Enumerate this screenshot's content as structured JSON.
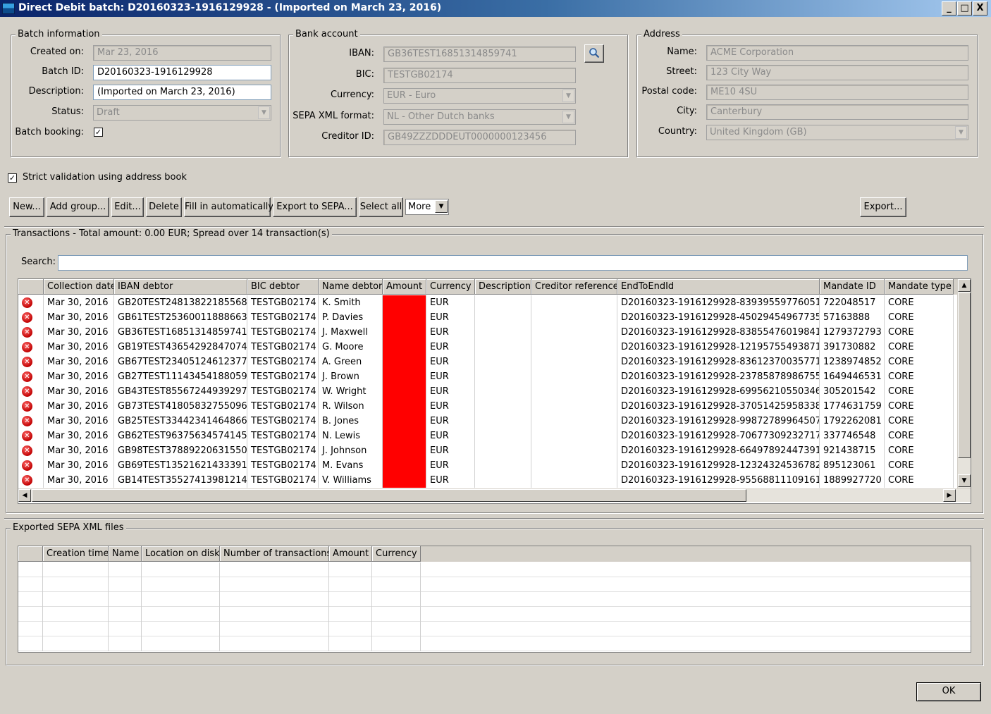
{
  "window": {
    "title": "Direct Debit batch: D20160323-1916129928 - (Imported on March 23, 2016)",
    "minimize": "_",
    "maximize": "□",
    "close": "X"
  },
  "batch": {
    "group_title": "Batch information",
    "created_label": "Created on:",
    "created_value": "Mar 23, 2016",
    "id_label": "Batch ID:",
    "id_value": "D20160323-1916129928",
    "desc_label": "Description:",
    "desc_value": "(Imported on March 23, 2016)",
    "status_label": "Status:",
    "status_value": "Draft",
    "booking_label": "Batch booking:",
    "booking_checked": "✓"
  },
  "bank": {
    "group_title": "Bank account",
    "iban_label": "IBAN:",
    "iban_value": "GB36TEST16851314859741",
    "bic_label": "BIC:",
    "bic_value": "TESTGB02174",
    "currency_label": "Currency:",
    "currency_value": "EUR - Euro",
    "sepa_label": "SEPA XML format:",
    "sepa_value": "NL - Other Dutch banks",
    "creditor_label": "Creditor ID:",
    "creditor_value": "GB49ZZZDDDEUT0000000123456",
    "search_icon": "magnifier-icon"
  },
  "address": {
    "group_title": "Address",
    "name_label": "Name:",
    "name_value": "ACME Corporation",
    "street_label": "Street:",
    "street_value": "123 City Way",
    "postal_label": "Postal code:",
    "postal_value": "ME10 4SU",
    "city_label": "City:",
    "city_value": "Canterbury",
    "country_label": "Country:",
    "country_value": "United Kingdom (GB)"
  },
  "strict": {
    "label": "Strict validation using address book",
    "checked": "✓"
  },
  "toolbar": {
    "new": "New...",
    "add_group": "Add group...",
    "edit": "Edit...",
    "delete": "Delete",
    "fill": "Fill in automatically",
    "export_sepa": "Export to SEPA...",
    "select_all": "Select all",
    "more": "More",
    "export": "Export..."
  },
  "transactions": {
    "group_title": "Transactions - Total amount: 0.00 EUR; Spread over 14 transaction(s)",
    "search_label": "Search:",
    "columns": [
      "",
      "Collection date",
      "IBAN debtor",
      "BIC debtor",
      "Name debtor",
      "Amount",
      "Currency",
      "Description",
      "Creditor reference",
      "EndToEndId",
      "Mandate ID",
      "Mandate type"
    ],
    "rows": [
      [
        "Mar 30, 2016",
        "GB20TEST24813822185568",
        "TESTGB02174",
        "K. Smith",
        "",
        "EUR",
        "",
        "",
        "D20160323-1916129928-83939559776051",
        "722048517",
        "CORE"
      ],
      [
        "Mar 30, 2016",
        "GB61TEST25360011888663",
        "TESTGB02174",
        "P. Davies",
        "",
        "EUR",
        "",
        "",
        "D20160323-1916129928-45029454967735",
        "57163888",
        "CORE"
      ],
      [
        "Mar 30, 2016",
        "GB36TEST16851314859741",
        "TESTGB02174",
        "J. Maxwell",
        "",
        "EUR",
        "",
        "",
        "D20160323-1916129928-83855476019841",
        "1279372793",
        "CORE"
      ],
      [
        "Mar 30, 2016",
        "GB19TEST43654292847074",
        "TESTGB02174",
        "G. Moore",
        "",
        "EUR",
        "",
        "",
        "D20160323-1916129928-12195755493871",
        "391730882",
        "CORE"
      ],
      [
        "Mar 30, 2016",
        "GB67TEST23405124612377",
        "TESTGB02174",
        "A. Green",
        "",
        "EUR",
        "",
        "",
        "D20160323-1916129928-83612370035771",
        "1238974852",
        "CORE"
      ],
      [
        "Mar 30, 2016",
        "GB27TEST11143454188059",
        "TESTGB02174",
        "J. Brown",
        "",
        "EUR",
        "",
        "",
        "D20160323-1916129928-23785878986755",
        "1649446531",
        "CORE"
      ],
      [
        "Mar 30, 2016",
        "GB43TEST85567244939297",
        "TESTGB02174",
        "W. Wright",
        "",
        "EUR",
        "",
        "",
        "D20160323-1916129928-69956210550346",
        "305201542",
        "CORE"
      ],
      [
        "Mar 30, 2016",
        "GB73TEST41805832755096",
        "TESTGB02174",
        "R. Wilson",
        "",
        "EUR",
        "",
        "",
        "D20160323-1916129928-37051425958338",
        "1774631759",
        "CORE"
      ],
      [
        "Mar 30, 2016",
        "GB25TEST33442341464866",
        "TESTGB02174",
        "B. Jones",
        "",
        "EUR",
        "",
        "",
        "D20160323-1916129928-99872789964507",
        "1792262081",
        "CORE"
      ],
      [
        "Mar 30, 2016",
        "GB62TEST96375634574145",
        "TESTGB02174",
        "N. Lewis",
        "",
        "EUR",
        "",
        "",
        "D20160323-1916129928-70677309232717",
        "337746548",
        "CORE"
      ],
      [
        "Mar 30, 2016",
        "GB98TEST37889220631550",
        "TESTGB02174",
        "J. Johnson",
        "",
        "EUR",
        "",
        "",
        "D20160323-1916129928-66497892447391",
        "921438715",
        "CORE"
      ],
      [
        "Mar 30, 2016",
        "GB69TEST13521621433391",
        "TESTGB02174",
        "M. Evans",
        "",
        "EUR",
        "",
        "",
        "D20160323-1916129928-12324324536782",
        "895123061",
        "CORE"
      ],
      [
        "Mar 30, 2016",
        "GB14TEST35527413981214",
        "TESTGB02174",
        "V. Williams",
        "",
        "EUR",
        "",
        "",
        "D20160323-1916129928-95568811109161",
        "1889927720",
        "CORE"
      ]
    ],
    "status_icon": "error-icon",
    "amount_color": "#ff0000"
  },
  "exported": {
    "group_title": "Exported SEPA XML files",
    "columns": [
      "",
      "Creation time",
      "Name",
      "Location on disk",
      "Number of transactions",
      "Amount",
      "Currency"
    ]
  },
  "ok": "OK"
}
